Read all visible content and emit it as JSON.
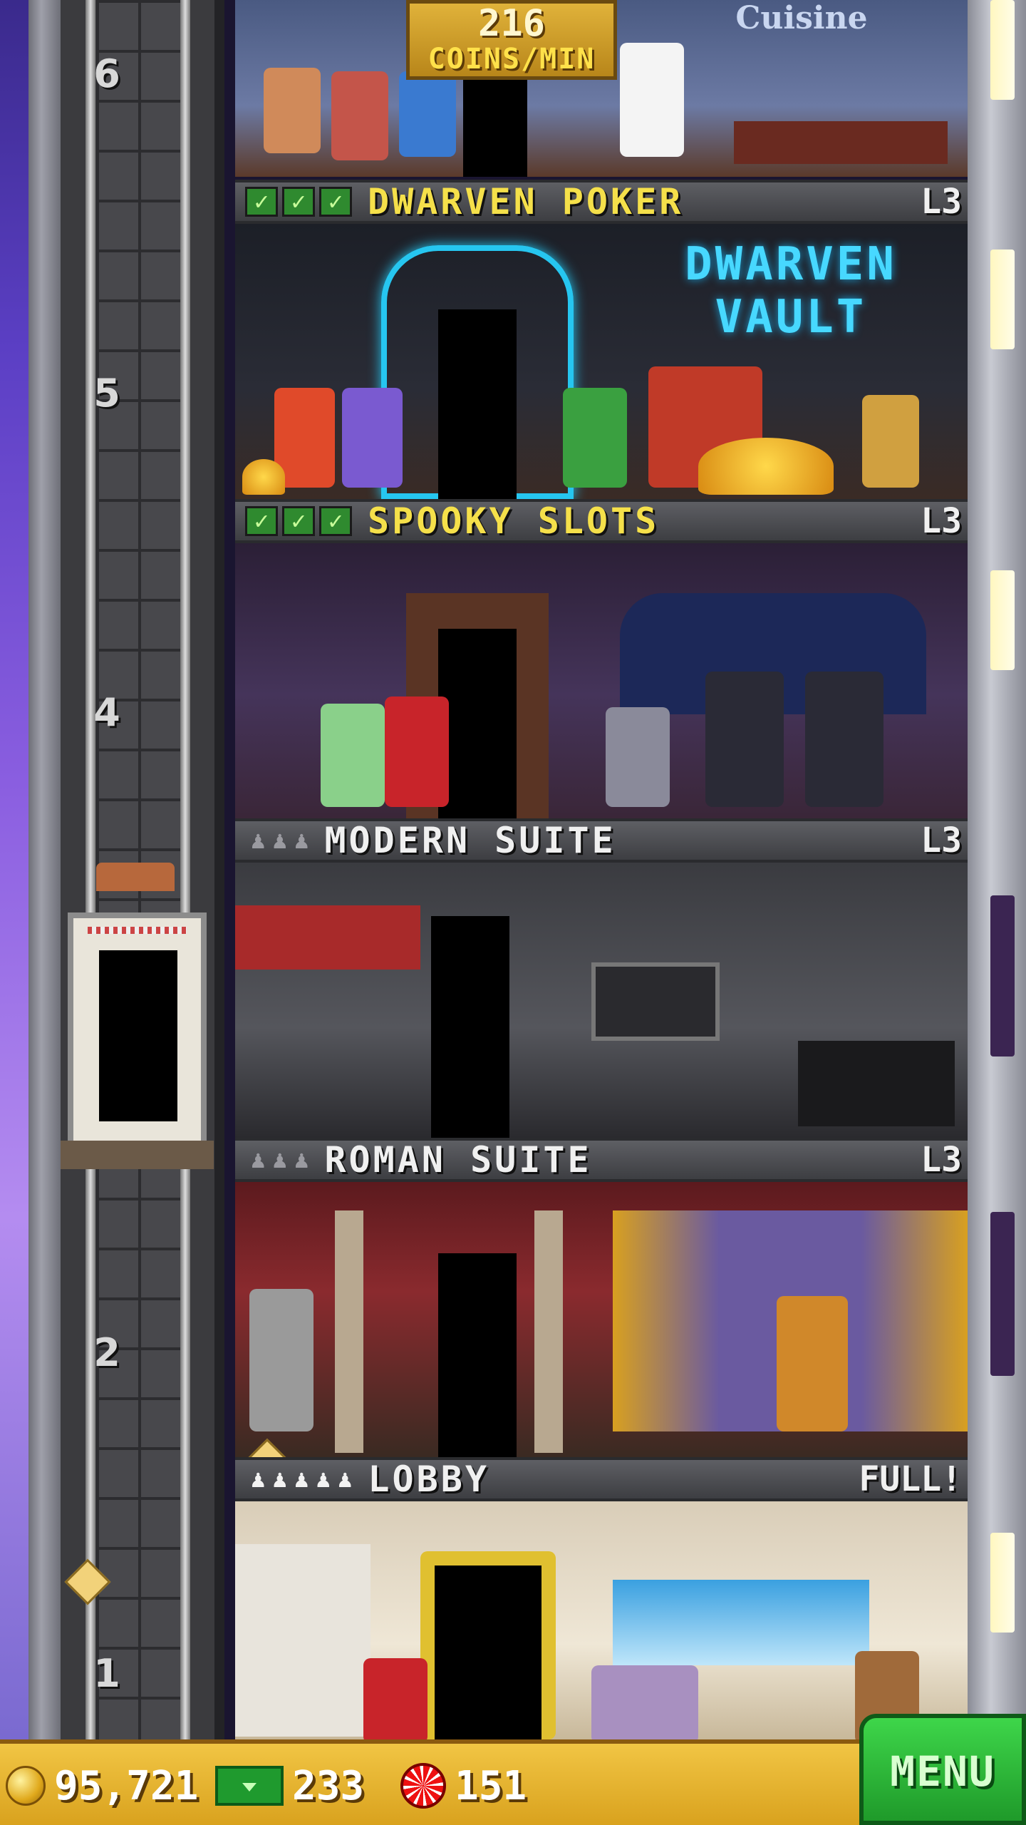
{
  "hud": {
    "coins": "95,721",
    "bux": "233",
    "chips": "151",
    "menu_label": "MENU"
  },
  "restaurant": {
    "rate_value": "216",
    "rate_unit": "COINS/MIN",
    "sign": "Cuisine"
  },
  "shaft": {
    "floor_numbers": [
      "6",
      "5",
      "4",
      "2",
      "1"
    ]
  },
  "floors": [
    {
      "name": "DWARVEN POKER",
      "level": "L3",
      "checks": 3,
      "sign": "DWARVEN VAULT"
    },
    {
      "name": "SPOOKY SLOTS",
      "level": "L3",
      "checks": 3
    },
    {
      "name": "MODERN SUITE",
      "level": "L3",
      "residents": 0
    },
    {
      "name": "ROMAN SUITE",
      "level": "L3",
      "residents": 0
    },
    {
      "name": "LOBBY",
      "level": "FULL!",
      "residents": 5
    }
  ],
  "colors": {
    "floor_title_gold": "#f5e04a",
    "bottom_bar": "#e2b02c",
    "menu_green": "#2fb83a"
  }
}
